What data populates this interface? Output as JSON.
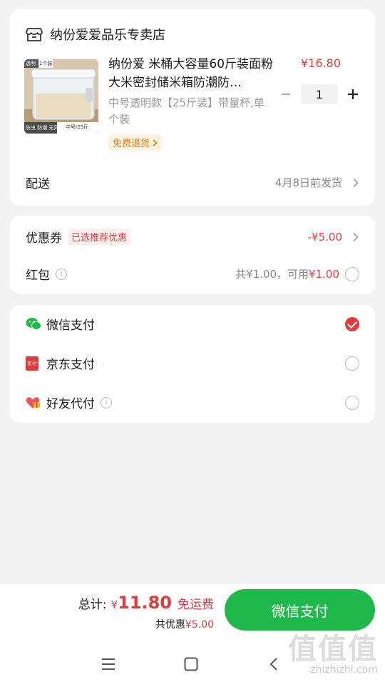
{
  "shop": {
    "name": "纳份爱爱品乐专卖店",
    "product": {
      "title": "纳份爱 米桶大容量60斤装面粉大米密封储米箱防潮防…",
      "spec": "中号透明款【25斤装】带量杯,单个装",
      "return_badge": "免费退货",
      "price": "¥16.80",
      "quantity": "1",
      "img_tag1": "透明",
      "img_tag2": "1个装",
      "img_label1": "防虫 防潮 无异味",
      "img_label2": "中号/25斤"
    },
    "delivery": {
      "label": "配送",
      "value": "4月8日前发货"
    }
  },
  "discounts": {
    "coupon": {
      "label": "优惠券",
      "tag": "已选推荐优惠",
      "value": "-¥5.00"
    },
    "redpacket": {
      "label": "红包",
      "total": "共¥1.00，可用",
      "usable": "¥1.00"
    }
  },
  "payment": {
    "methods": [
      {
        "label": "微信支付",
        "icon": "wechat-icon",
        "selected": true
      },
      {
        "label": "京东支付",
        "icon": "jdpay-icon",
        "selected": false
      },
      {
        "label": "好友代付",
        "icon": "heart-gift-icon",
        "selected": false
      }
    ],
    "jd_icon_text": "东付"
  },
  "summary": {
    "total_label": "总计:",
    "currency": "¥",
    "total_amount": "11.80",
    "free_shipping": "免运费",
    "saved_prefix": "共优惠",
    "saved_amount": "¥5.00",
    "pay_button": "微信支付"
  },
  "watermark": {
    "big": "值值值",
    "small": "zhizhizhi.com"
  },
  "colors": {
    "accent_red": "#e4393c",
    "pay_green": "#1fb84a"
  }
}
